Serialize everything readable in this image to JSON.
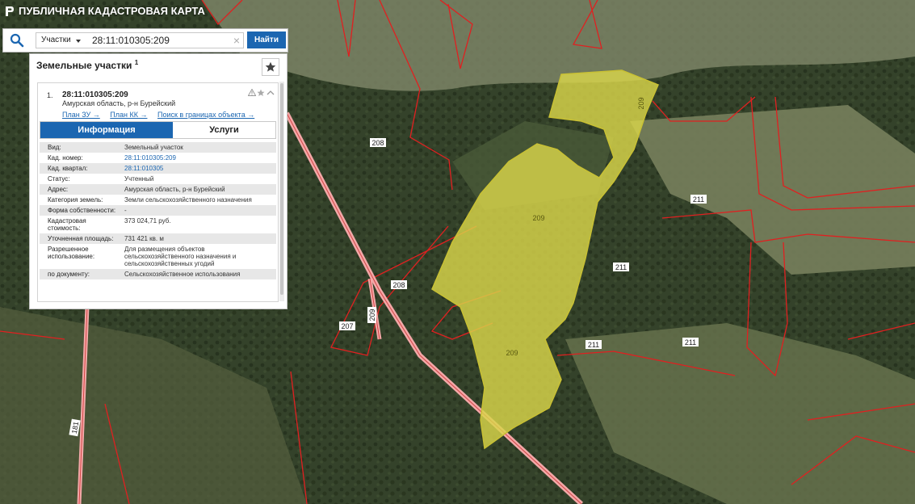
{
  "app": {
    "title": "ПУБЛИЧНАЯ КАДАСТРОВАЯ КАРТА"
  },
  "search": {
    "type_label": "Участки",
    "query": "28:11:010305:209",
    "button_label": "Найти"
  },
  "panel": {
    "title": "Земельные участки",
    "count": "1",
    "item": {
      "number": "1.",
      "cad_number": "28:11:010305:209",
      "address": "Амурская область, р-н Бурейский",
      "links": [
        "План ЗУ →",
        "План КК →",
        "Поиск в границах объекта →"
      ]
    },
    "tabs": [
      {
        "label": "Информация"
      },
      {
        "label": "Услуги"
      }
    ],
    "attributes": [
      {
        "key": "Вид:",
        "value": "Земельный участок"
      },
      {
        "key": "Кад. номер:",
        "value": "28:11:010305:209"
      },
      {
        "key": "Кад. квартал:",
        "value": "28:11:010305"
      },
      {
        "key": "Статус:",
        "value": "Учтенный"
      },
      {
        "key": "Адрес:",
        "value": "Амурская область, р-н Бурейский"
      },
      {
        "key": "Категория земель:",
        "value": "Земли сельскохозяйственного назначения"
      },
      {
        "key": "Форма собственности:",
        "value": "-"
      },
      {
        "key": "Кадастровая стоимость:",
        "value": "373 024,71 руб."
      },
      {
        "key": "Уточненная площадь:",
        "value": "731 421 кв. м"
      },
      {
        "key": "Разрешенное использование:",
        "value": "Для размещения объектов сельскохозяйственного назначения и сельскохозяйственных угодий"
      },
      {
        "key": "по документу:",
        "value": "Сельскохозяйственное использования"
      }
    ]
  },
  "map": {
    "labels": {
      "l208a": "208",
      "l208b": "208",
      "l209a": "209",
      "l209b": "209",
      "l209c": "209",
      "l209d": "209",
      "l211a": "211",
      "l211b": "211",
      "l211c": "211",
      "l211d": "211",
      "l207": "207",
      "l181": "181"
    },
    "colors": {
      "parcel_fill": "#d9d54a",
      "boundary": "#e02020",
      "road": "#f3a8a8",
      "forest": "#2f3d24",
      "field": "#6f7a55"
    }
  }
}
